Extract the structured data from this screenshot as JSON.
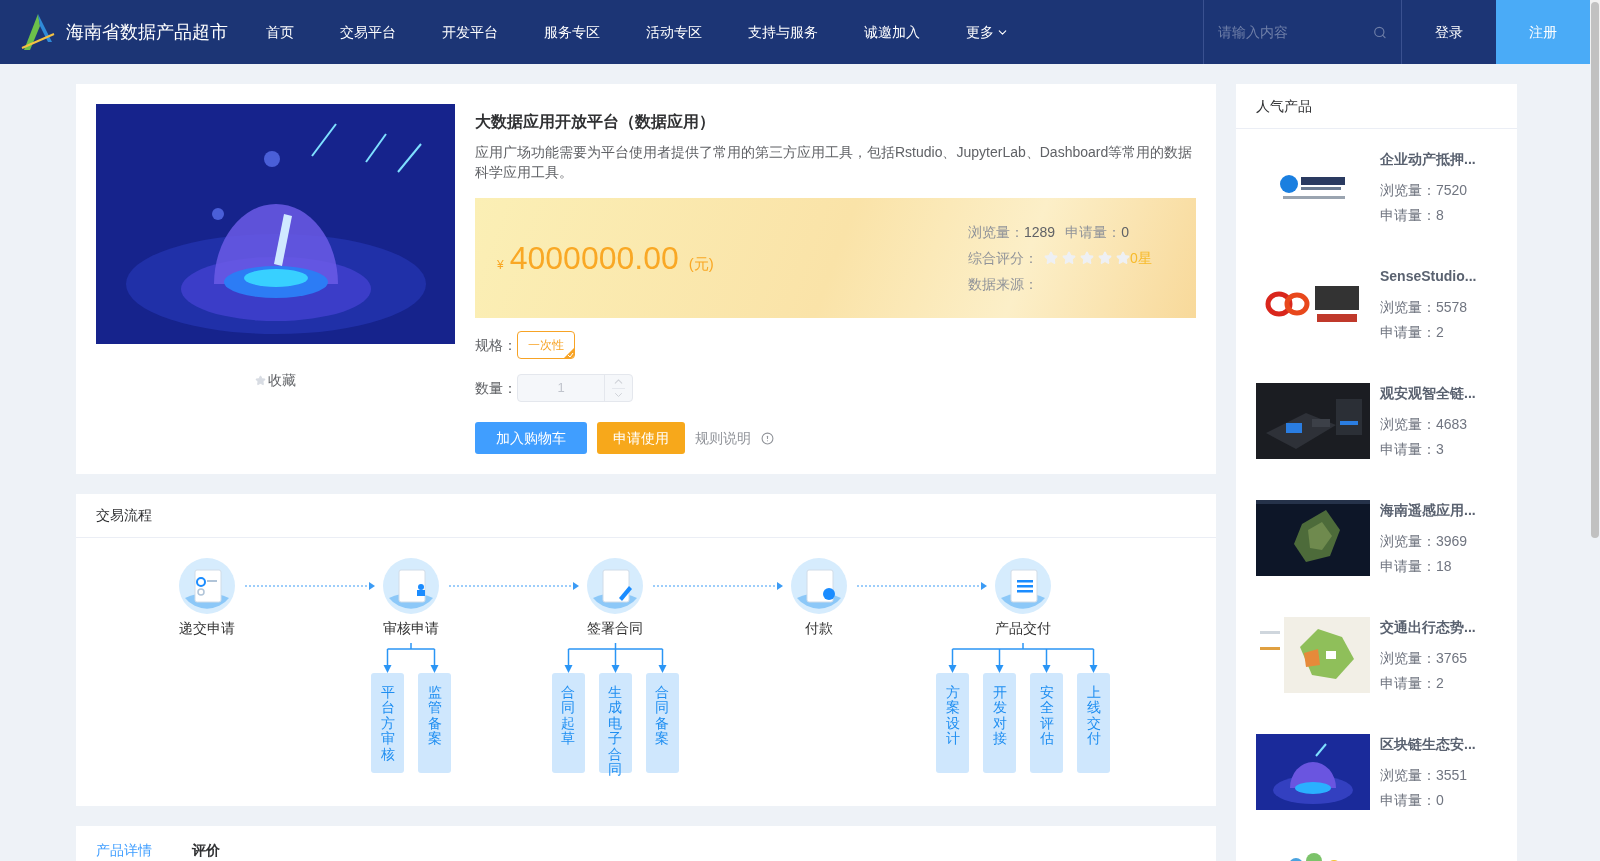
{
  "header": {
    "site_title": "海南省数据产品超市",
    "nav": [
      {
        "label": "首页",
        "dropdown": false
      },
      {
        "label": "交易平台",
        "dropdown": false
      },
      {
        "label": "开发平台",
        "dropdown": false
      },
      {
        "label": "服务专区",
        "dropdown": false
      },
      {
        "label": "活动专区",
        "dropdown": false
      },
      {
        "label": "支持与服务",
        "dropdown": false
      },
      {
        "label": "诚邀加入",
        "dropdown": false
      },
      {
        "label": "更多",
        "dropdown": true
      }
    ],
    "search": {
      "placeholder": "请输入内容"
    },
    "login": "登录",
    "register": "注册"
  },
  "product": {
    "favorite": "收藏",
    "title": "大数据应用开放平台（数据应用）",
    "description": "应用广场功能需要为平台使用者提供了常用的第三方应用工具，包括Rstudio、JupyterLab、Dashboard等常用的数据科学应用工具。",
    "currency": "¥",
    "price": "4000000.00",
    "unit": "(元)",
    "stats": {
      "views_label": "浏览量：",
      "views": "1289",
      "applies_label": "申请量：",
      "applies": "0",
      "rating_label": "综合评分：",
      "stars": 0,
      "rating_text": "0星",
      "source_label": "数据来源："
    },
    "spec_label": "规格：",
    "specs": [
      {
        "label": "一次性",
        "selected": true
      }
    ],
    "quantity_label": "数量：",
    "quantity": "1",
    "add_to_cart": "加入购物车",
    "apply": "申请使用",
    "rules": "规则说明"
  },
  "flow": {
    "title": "交易流程",
    "steps": [
      {
        "label": "递交申请"
      },
      {
        "label": "审核申请",
        "children": [
          {
            "label": "平台方审核"
          },
          {
            "label": "监管备案"
          }
        ]
      },
      {
        "label": "签署合同",
        "children": [
          {
            "label": "合同起草"
          },
          {
            "label": "生成电子合同"
          },
          {
            "label": "合同备案"
          }
        ]
      },
      {
        "label": "付款"
      },
      {
        "label": "产品交付",
        "children": [
          {
            "label": "方案设计"
          },
          {
            "label": "开发对接"
          },
          {
            "label": "安全评估"
          },
          {
            "label": "上线交付"
          }
        ]
      }
    ]
  },
  "detail_tabs": [
    {
      "label": "产品详情",
      "selected": true
    },
    {
      "label": "评价",
      "selected": false
    }
  ],
  "popular": {
    "title": "人气产品",
    "items": [
      {
        "name": "企业动产抵押...",
        "views": "浏览量：7520",
        "applies": "申请量：8",
        "kind": "picture"
      },
      {
        "name": "SenseStudio...",
        "views": "浏览量：5578",
        "applies": "申请量：2",
        "kind": "picture"
      },
      {
        "name": "观安观智全链...",
        "views": "浏览量：4683",
        "applies": "申请量：3",
        "kind": "picture"
      },
      {
        "name": "海南遥感应用...",
        "views": "浏览量：3969",
        "applies": "申请量：18",
        "kind": "picture"
      },
      {
        "name": "交通出行态势...",
        "views": "浏览量：3765",
        "applies": "申请量：2",
        "kind": "picture"
      },
      {
        "name": "区块链生态安...",
        "views": "浏览量：3551",
        "applies": "申请量：0",
        "kind": "picture"
      },
      {
        "kind": "picture"
      }
    ]
  }
}
